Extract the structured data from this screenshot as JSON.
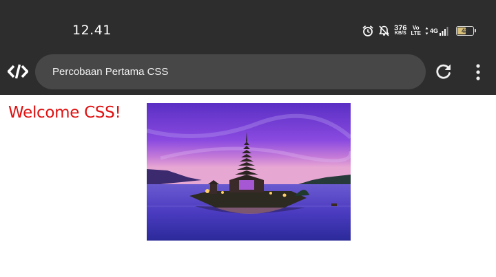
{
  "status_bar": {
    "time": "12.41",
    "net_speed": "376",
    "net_unit": "KB/S",
    "volte_top": "Vo",
    "volte_bottom": "LTE",
    "network": "4G",
    "battery": "48",
    "battery_level": 0.48
  },
  "toolbar": {
    "page_title": "Percobaan Pertama CSS"
  },
  "page": {
    "heading": "Welcome CSS!",
    "image_subject": "temple-on-lake-at-dusk"
  },
  "colors": {
    "chrome": "#2d2d2d",
    "url_bar": "#474747",
    "heading": "#e01010"
  }
}
